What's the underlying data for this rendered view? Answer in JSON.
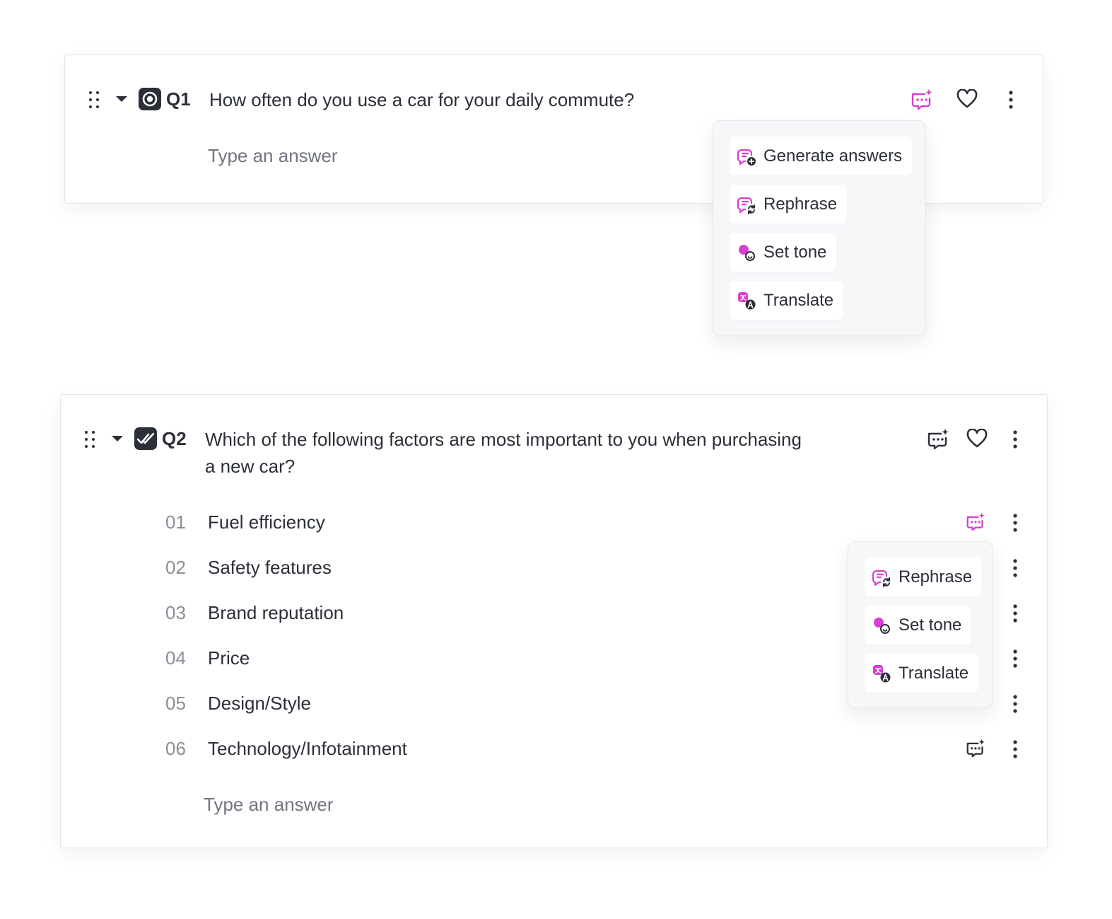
{
  "colors": {
    "accent": "#d63fd1",
    "text": "#2b2f38",
    "muted": "#717580",
    "number": "#8a8e98"
  },
  "q1": {
    "number": "Q1",
    "type_icon": "single-choice-icon",
    "question": "How often do you use a car for your daily commute?",
    "placeholder": "Type an answer",
    "ai_menu": {
      "items": [
        {
          "label": "Generate answers",
          "icon": "generate-answers-icon"
        },
        {
          "label": "Rephrase",
          "icon": "rephrase-icon"
        },
        {
          "label": "Set tone",
          "icon": "set-tone-icon"
        },
        {
          "label": "Translate",
          "icon": "translate-icon"
        }
      ]
    }
  },
  "q2": {
    "number": "Q2",
    "type_icon": "multiple-choice-icon",
    "question_line1": "Which of the following factors are most important to you when purchasing",
    "question_line2": "a new car?",
    "placeholder": "Type an answer",
    "options": [
      {
        "num": "01",
        "label": "Fuel efficiency"
      },
      {
        "num": "02",
        "label": "Safety features"
      },
      {
        "num": "03",
        "label": "Brand reputation"
      },
      {
        "num": "04",
        "label": "Price"
      },
      {
        "num": "05",
        "label": "Design/Style"
      },
      {
        "num": "06",
        "label": "Technology/Infotainment"
      }
    ],
    "ai_menu": {
      "items": [
        {
          "label": "Rephrase",
          "icon": "rephrase-icon"
        },
        {
          "label": "Set tone",
          "icon": "set-tone-icon"
        },
        {
          "label": "Translate",
          "icon": "translate-icon"
        }
      ]
    }
  }
}
